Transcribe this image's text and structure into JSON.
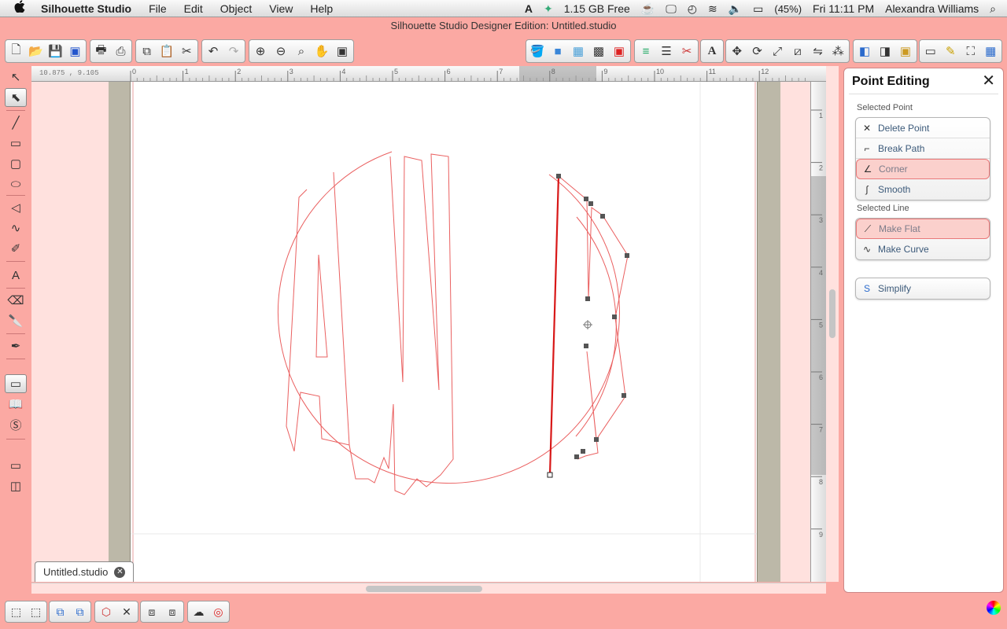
{
  "menubar": {
    "apple_icon": "apple-logo",
    "app_name": "Silhouette Studio",
    "menus": [
      "File",
      "Edit",
      "Object",
      "View",
      "Help"
    ],
    "status": {
      "memory": "1.15 GB Free",
      "battery": "(45%)",
      "clock": "Fri 11:11 PM",
      "user": "Alexandra Williams"
    }
  },
  "window": {
    "title": "Silhouette Studio Designer Edition: Untitled.studio"
  },
  "canvas": {
    "coordinate_readout": "10.875 , 9.105",
    "ruler_top_labels": [
      "0",
      "1",
      "2",
      "3",
      "4",
      "5",
      "6",
      "7",
      "8",
      "9",
      "10",
      "11",
      "12"
    ],
    "ruler_right_labels": [
      "1",
      "2",
      "3",
      "4",
      "5",
      "6",
      "7",
      "8",
      "9"
    ],
    "document_tab": "Untitled.studio",
    "accent_color": "#e8474a"
  },
  "panel": {
    "title": "Point Editing",
    "selected_point_label": "Selected Point",
    "selected_point_items": [
      {
        "label": "Delete Point",
        "selected": false
      },
      {
        "label": "Break Path",
        "selected": false
      },
      {
        "label": "Corner",
        "selected": true
      },
      {
        "label": "Smooth",
        "selected": false
      }
    ],
    "selected_line_label": "Selected Line",
    "selected_line_items": [
      {
        "label": "Make Flat",
        "selected": true
      },
      {
        "label": "Make Curve",
        "selected": false
      }
    ],
    "simplify_label": "Simplify"
  }
}
